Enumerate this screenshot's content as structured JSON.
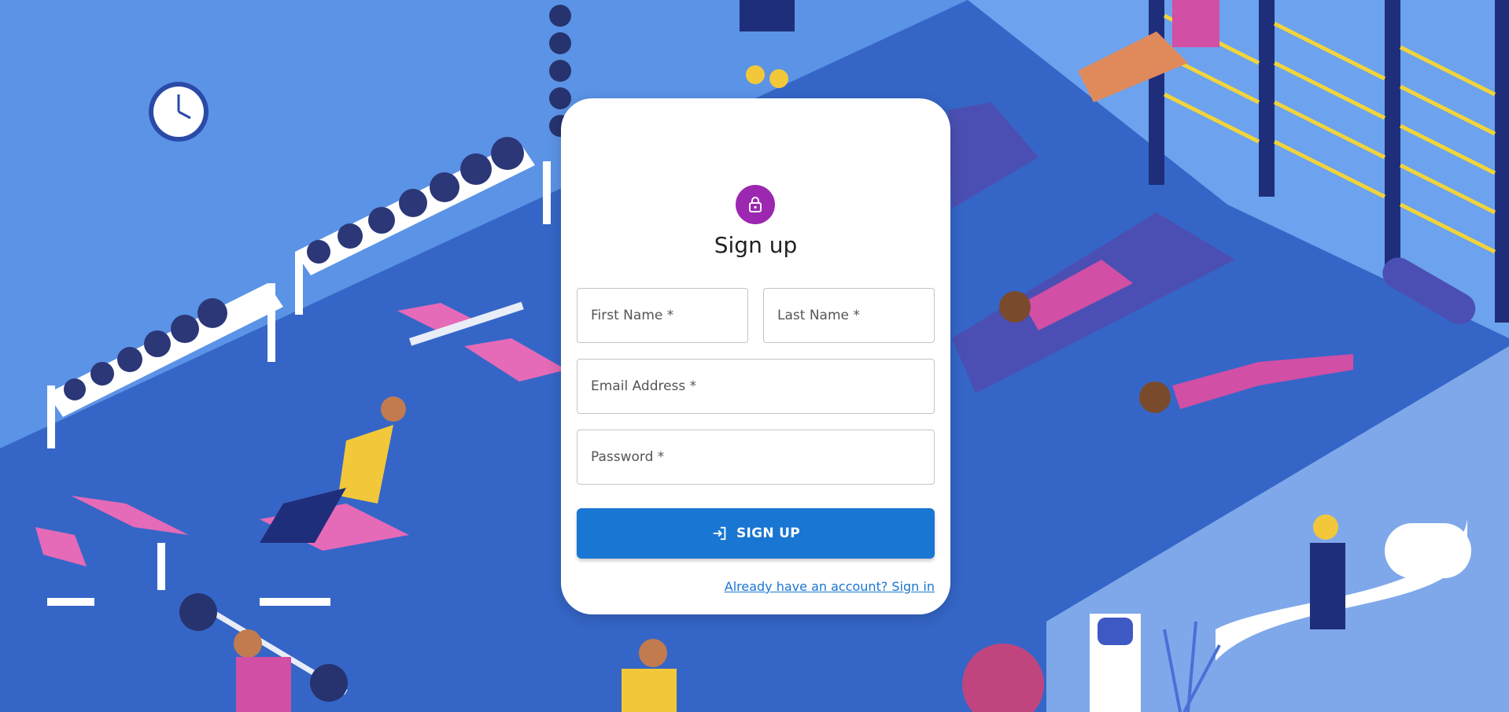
{
  "form": {
    "title": "Sign up",
    "first_name_placeholder": "First Name *",
    "last_name_placeholder": "Last Name *",
    "email_placeholder": "Email Address *",
    "password_placeholder": "Password *",
    "submit_label": "SIGN UP",
    "signin_link": "Already have an account? Sign in"
  },
  "icons": {
    "avatar": "lock-icon",
    "submit": "login-arrow-icon"
  },
  "colors": {
    "avatar_bg": "#9c27b0",
    "primary": "#1976d2",
    "background": "#3b6fd1"
  }
}
